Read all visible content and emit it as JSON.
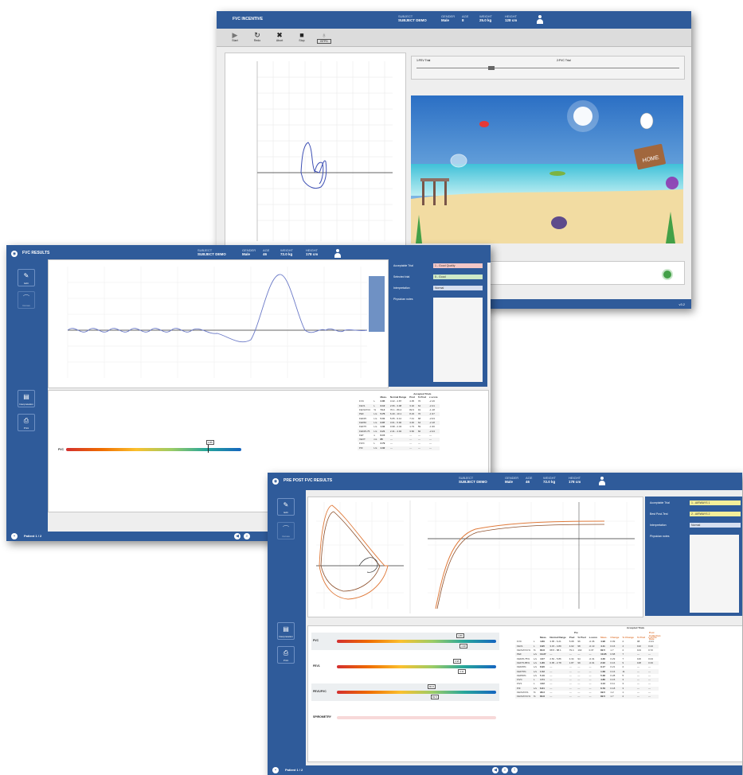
{
  "windows": {
    "top": {
      "title": "FVC INCENTIVE",
      "meta": [
        {
          "label": "SUBJECT",
          "value": "SUBJECT DEMO"
        },
        {
          "label": "GENDER",
          "value": "Male"
        },
        {
          "label": "AGE",
          "value": "8"
        },
        {
          "label": "WEIGHT",
          "value": "25.0 kg"
        },
        {
          "label": "HEIGHT",
          "value": "128 cm"
        }
      ],
      "toolbar": [
        {
          "label": "Start",
          "icon": "play-icon",
          "glyph": "▶"
        },
        {
          "label": "Redo",
          "icon": "redo-icon",
          "glyph": "↻"
        },
        {
          "label": "Abort",
          "icon": "abort-icon",
          "glyph": "✖"
        },
        {
          "label": "Stop",
          "icon": "stop-icon",
          "glyph": "■"
        },
        {
          "label": "BTPS",
          "icon": "btps-icon",
          "glyph": "♁"
        }
      ],
      "slider_a": "1:FEV Trial",
      "slider_b": "2:FVC Trial",
      "game_sign": "HOME",
      "footer": "v3.2"
    },
    "middle": {
      "title": "FVC RESULTS",
      "meta": [
        {
          "label": "SUBJECT",
          "value": "SUBJECT DEMO"
        },
        {
          "label": "GENDER",
          "value": "Male"
        },
        {
          "label": "AGE",
          "value": "46"
        },
        {
          "label": "WEIGHT",
          "value": "72.0 kg"
        },
        {
          "label": "HEIGHT",
          "value": "178 cm"
        }
      ],
      "sidebar_top": [
        {
          "label": "Edit",
          "icon": "pencil-icon",
          "glyph": "✎"
        },
        {
          "label": "Curves",
          "icon": "curve-icon",
          "glyph": "⌒"
        }
      ],
      "sidebar_bottom": [
        {
          "label": "Interpretation",
          "icon": "report-icon",
          "glyph": "▤"
        },
        {
          "label": "Print",
          "icon": "print-icon",
          "glyph": "⎙"
        }
      ],
      "form": [
        {
          "label": "Acceptable Trial",
          "value": "1 - Good Quality",
          "color": "#f3c7c7"
        },
        {
          "label": "Selected trial",
          "value": "5 - Good",
          "color": "#cfe9c7"
        },
        {
          "label": "Interpretation",
          "value": "Normal",
          "color": "#d6dff0"
        },
        {
          "label": "Physician notes",
          "value": ""
        }
      ],
      "gauge": {
        "label": "FVC",
        "marker": "2.85",
        "fill": 0.88
      },
      "table_header": [
        "",
        "",
        "Meas.",
        "Normal Range",
        "Pred",
        "% Pred",
        "z-score"
      ],
      "table_group": "Accepted Trials",
      "table_rows": [
        [
          "FVC",
          "L",
          "2.85",
          "3.22 - 4.87",
          "4.05",
          "70",
          "-2.16"
        ],
        [
          "FEV1",
          "L",
          "2.12",
          "2.66 - 3.98",
          "3.32",
          "64",
          "-2.41"
        ],
        [
          "FEV1/FVC",
          "%",
          "74.4",
          "70.1 - 89.4",
          "82.0",
          "91",
          "-1.18"
        ],
        [
          "PEF",
          "L/s",
          "5.76",
          "6.40 - 10.1",
          "8.23",
          "70",
          "-1.97"
        ],
        [
          "FEF25",
          "L/s",
          "5.01",
          "5.65 - 9.12",
          "7.41",
          "68",
          "-2.03"
        ],
        [
          "FEF50",
          "L/s",
          "2.87",
          "3.01 - 5.90",
          "4.46",
          "64",
          "-2.18"
        ],
        [
          "FEF75",
          "L/s",
          "1.02",
          "0.98 - 2.43",
          "1.73",
          "59",
          "-1.96"
        ],
        [
          "FEF25-75",
          "L/s",
          "2.21",
          "2.41 - 4.92",
          "3.66",
          "60",
          "-2.24"
        ],
        [
          "FET",
          "s",
          "6.15",
          "---",
          "---",
          "---",
          "---"
        ],
        [
          "VEXT",
          "mL",
          "85",
          "---",
          "---",
          "---",
          "---"
        ],
        [
          "FIVC",
          "L",
          "2.79",
          "---",
          "---",
          "---",
          "---"
        ],
        [
          "PIF",
          "L/s",
          "4.02",
          "---",
          "---",
          "---",
          "---"
        ]
      ],
      "footer": "Patient 1 / 2"
    },
    "bottom": {
      "title": "PRE POST FVC RESULTS",
      "meta": [
        {
          "label": "SUBJECT",
          "value": "SUBJECT DEMO"
        },
        {
          "label": "GENDER",
          "value": "Male"
        },
        {
          "label": "AGE",
          "value": "46"
        },
        {
          "label": "WEIGHT",
          "value": "72.0 kg"
        },
        {
          "label": "HEIGHT",
          "value": "178 cm"
        }
      ],
      "form": [
        {
          "label": "Acceptable Trial",
          "value": "1 - AIRWAYS 1",
          "color": "#f4ef9a"
        },
        {
          "label": "Best Post-Test",
          "value": "2 - AIRWAYS 2",
          "color": "#f4ef9a"
        },
        {
          "label": "Interpretation",
          "value": "Normal",
          "color": "#d6dff0"
        },
        {
          "label": "Physician notes",
          "value": ""
        }
      ],
      "gauges": [
        {
          "label": "FVC",
          "pre": "4.89",
          "post": "4.98",
          "fill": 0.86
        },
        {
          "label": "FEV1",
          "pre": "3.95",
          "post": "4.11",
          "fill": 0.84
        },
        {
          "label": "FEV1/FVC",
          "pre": "80.8",
          "post": "82.5",
          "fill": 0.6
        },
        {
          "label": "SPIROMETRY",
          "pre": "",
          "post": "",
          "fill": 0.0
        }
      ],
      "table_header": [
        "",
        "",
        "Meas.",
        "Normal Range",
        "Pred",
        "% Pred",
        "z-score",
        "Meas.",
        "Change",
        "% Change",
        "% Pred",
        "z-score"
      ],
      "table_group_pre": "Pre",
      "table_group_post": "Post Collection Date",
      "table_group_acc": "Accepted Trials",
      "table_rows": [
        [
          "FVC",
          "L",
          "4.89",
          "3.95 - 6.21",
          "5.08",
          "96",
          "-0.36",
          "4.98",
          "0.09",
          "2",
          "98",
          "-0.21"
        ],
        [
          "FEV1",
          "L",
          "3.95",
          "3.15 - 4.89",
          "4.02",
          "98",
          "-0.13",
          "4.11",
          "0.16",
          "4",
          "102",
          "0.24"
        ],
        [
          "FEV1/FVC%",
          "%",
          "80.8",
          "68.5 - 88.1",
          "79.4",
          "102",
          "0.37",
          "82.5",
          "1.7",
          "2",
          "104",
          "0.72"
        ],
        [
          "PEF",
          "L/s",
          "10.27",
          "---",
          "---",
          "---",
          "---",
          "10.95",
          "0.68",
          "7",
          "---",
          "---"
        ],
        [
          "FEF25-75%",
          "L/s",
          "4.07",
          "2.81 - 5.86",
          "4.34",
          "94",
          "-0.31",
          "4.36",
          "0.29",
          "7",
          "100",
          "0.04"
        ],
        [
          "FEF75-85%",
          "L/s",
          "1.86",
          "0.95 - 2.78",
          "1.87",
          "99",
          "-0.01",
          "2.02",
          "0.16",
          "9",
          "108",
          "0.33"
        ],
        [
          "FEF25%",
          "L/s",
          "8.96",
          "---",
          "---",
          "---",
          "---",
          "9.17",
          "0.21",
          "2",
          "---",
          "---"
        ],
        [
          "FEF75%",
          "L/s",
          "1.52",
          "---",
          "---",
          "---",
          "---",
          "1.68",
          "0.16",
          "11",
          "---",
          "---"
        ],
        [
          "FEF50%",
          "L/s",
          "5.10",
          "---",
          "---",
          "---",
          "---",
          "5.38",
          "0.28",
          "5",
          "---",
          "---"
        ],
        [
          "FIVC",
          "L",
          "4.71",
          "---",
          "---",
          "---",
          "---",
          "4.86",
          "0.15",
          "3",
          "---",
          "---"
        ],
        [
          "FIV1",
          "L",
          "4.02",
          "---",
          "---",
          "---",
          "---",
          "4.13",
          "0.11",
          "3",
          "---",
          "---"
        ],
        [
          "PIF",
          "L/s",
          "6.61",
          "---",
          "---",
          "---",
          "---",
          "6.79",
          "0.18",
          "3",
          "---",
          "---"
        ],
        [
          "FEV1/FIV1",
          "%",
          "98.3",
          "---",
          "---",
          "---",
          "---",
          "99.5",
          "1.2",
          "1",
          "---",
          "---"
        ],
        [
          "FEV1/FVC%",
          "%",
          "80.8",
          "---",
          "---",
          "---",
          "---",
          "82.5",
          "1.7",
          "2",
          "---",
          "---"
        ]
      ],
      "footer": "Patient 1 / 2"
    }
  }
}
